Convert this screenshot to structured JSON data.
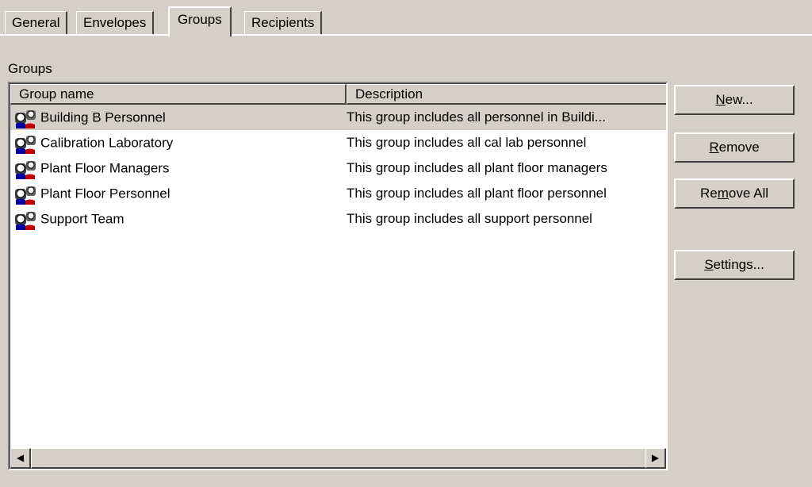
{
  "tabs": [
    {
      "label": "General",
      "active": false
    },
    {
      "label": "Envelopes",
      "active": false
    },
    {
      "label": "Groups",
      "active": true
    },
    {
      "label": "Recipients",
      "active": false
    }
  ],
  "groups_label": "Groups",
  "table": {
    "columns": [
      "Group name",
      "Description"
    ],
    "rows": [
      {
        "name": "Building B Personnel",
        "description": "This group includes all personnel in Buildi...",
        "selected": true
      },
      {
        "name": "Calibration Laboratory",
        "description": "This group includes all cal lab personnel",
        "selected": false
      },
      {
        "name": "Plant Floor Managers",
        "description": "This group includes all plant floor managers",
        "selected": false
      },
      {
        "name": "Plant Floor Personnel",
        "description": "This group includes all plant floor personnel",
        "selected": false
      },
      {
        "name": "Support Team",
        "description": "This group includes all support personnel",
        "selected": false
      }
    ],
    "row_icon": "group-people-icon"
  },
  "buttons": {
    "new": {
      "pre": "",
      "u": "N",
      "post": "ew..."
    },
    "remove": {
      "pre": "",
      "u": "R",
      "post": "emove"
    },
    "remove_all": {
      "pre": "Re",
      "u": "m",
      "post": "ove All"
    },
    "settings": {
      "pre": "",
      "u": "S",
      "post": "ettings..."
    }
  },
  "scrollbar": {
    "left_arrow": "◀",
    "right_arrow": "▶"
  }
}
